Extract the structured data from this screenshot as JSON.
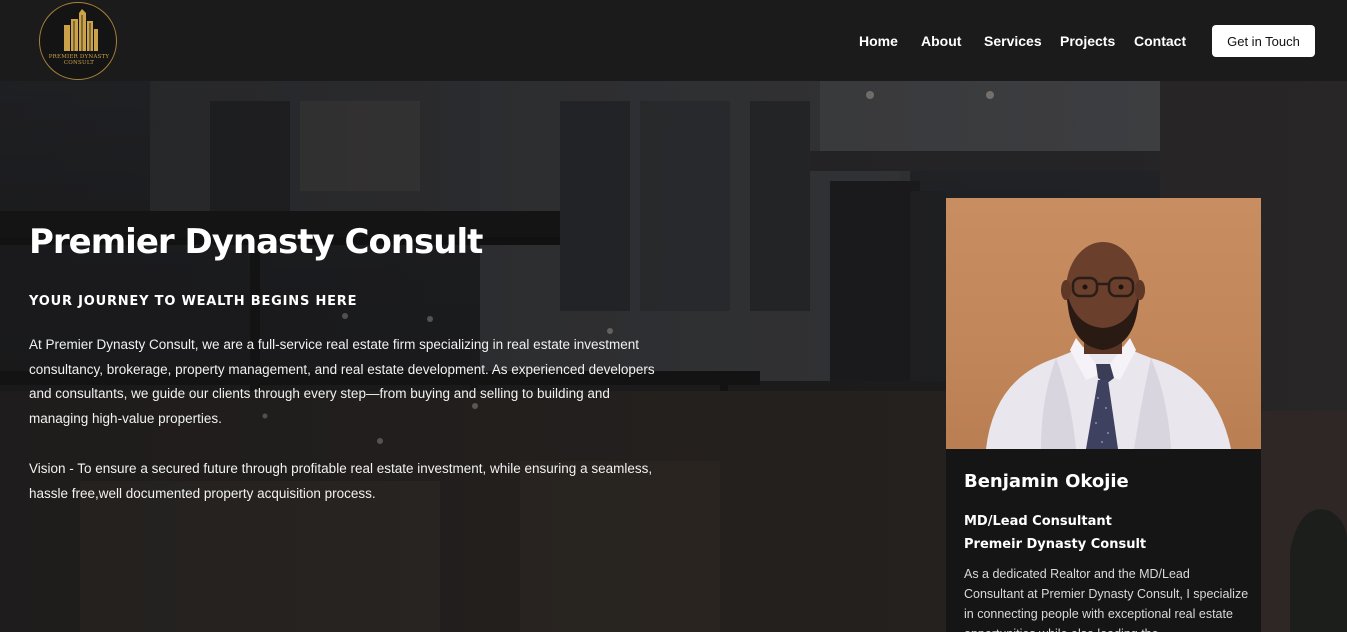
{
  "header": {
    "logo_text": "PREMIER DYNASTY CONSULT",
    "nav": [
      {
        "label": "Home"
      },
      {
        "label": "About"
      },
      {
        "label": "Services"
      },
      {
        "label": "Projects"
      },
      {
        "label": "Contact"
      }
    ],
    "cta_label": "Get in Touch"
  },
  "hero": {
    "title": "Premier Dynasty Consult",
    "tagline": "YOUR JOURNEY TO WEALTH BEGINS HERE",
    "paragraph1": "At Premier Dynasty Consult, we are a full-service real estate firm specializing in real estate investment consultancy, brokerage, property management, and real estate development. As experienced developers and consultants, we guide our clients through every step—from buying and selling to building and managing high-value properties.",
    "paragraph2": "Vision - To ensure a secured future through profitable real estate investment, while ensuring a seamless, hassle free,well documented property acquisition process."
  },
  "profile": {
    "name": "Benjamin Okojie",
    "role": "MD/Lead Consultant",
    "company": "Premeir Dynasty Consult",
    "bio": "As a dedicated Realtor and the MD/Lead Consultant at Premier Dynasty Consult, I specialize in connecting people with exceptional real estate opportunities while also leading the"
  },
  "colors": {
    "header_bg": "#1c1b1c",
    "logo_gold": "#c9a24a",
    "card_bg": "#151515",
    "photo_bg": "#c4895c"
  }
}
